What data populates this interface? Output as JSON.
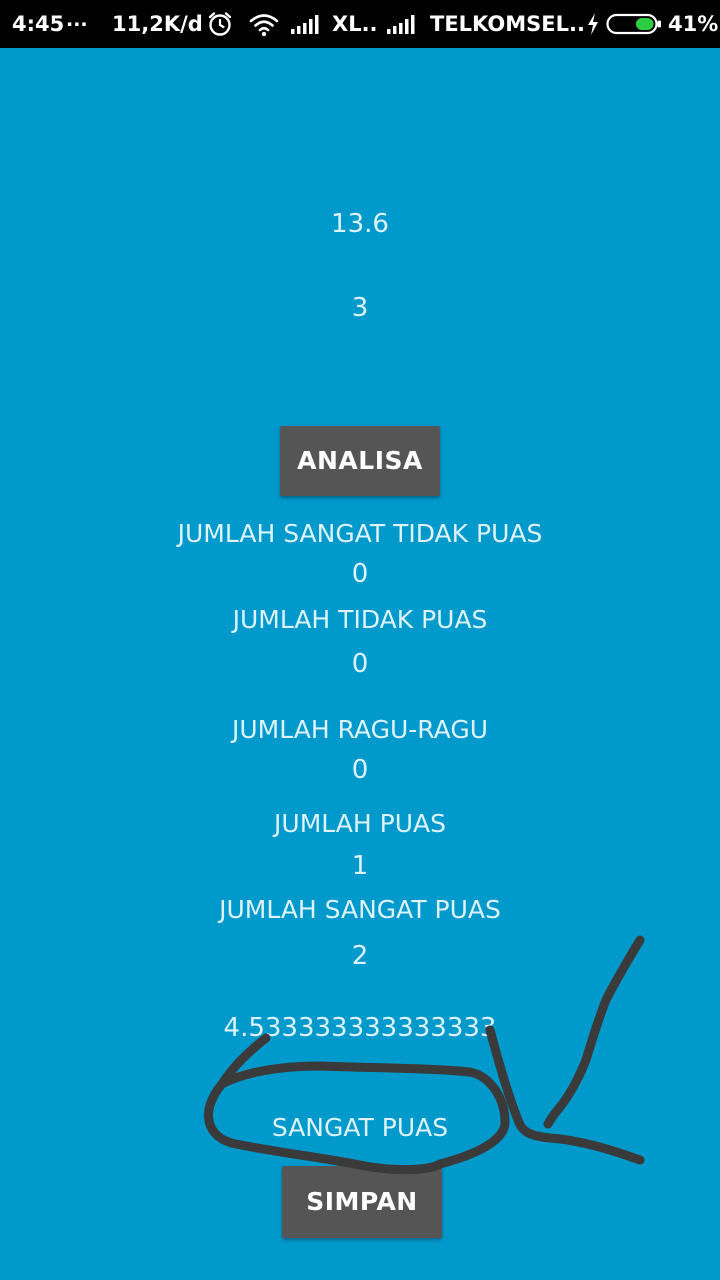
{
  "status_bar": {
    "time": "4:45",
    "dots": "...",
    "speed": "11,2K/d",
    "carrier1": "XL..",
    "carrier2": "TELKOMSEL..",
    "battery_percent": "41%",
    "battery_level": 0.41,
    "icons": [
      "alarm-icon",
      "wifi-icon",
      "signal-icon",
      "charging-icon",
      "battery-icon"
    ]
  },
  "main": {
    "value_top_1": "13.6",
    "value_top_2": "3",
    "analyze_button": "ANALISA",
    "counts": [
      {
        "label": "JUMLAH SANGAT TIDAK PUAS",
        "value": "0"
      },
      {
        "label": "JUMLAH TIDAK PUAS",
        "value": "0"
      },
      {
        "label": "JUMLAH RAGU-RAGU",
        "value": "0"
      },
      {
        "label": "JUMLAH PUAS",
        "value": "1"
      },
      {
        "label": "JUMLAH SANGAT PUAS",
        "value": "2"
      }
    ],
    "average": "4.533333333333333",
    "result": "SANGAT PUAS",
    "save_button": "SIMPAN"
  },
  "colors": {
    "background": "#0099CC",
    "text": "#DDF2FA",
    "button": "#555555",
    "scribble": "#3A3A3A"
  }
}
